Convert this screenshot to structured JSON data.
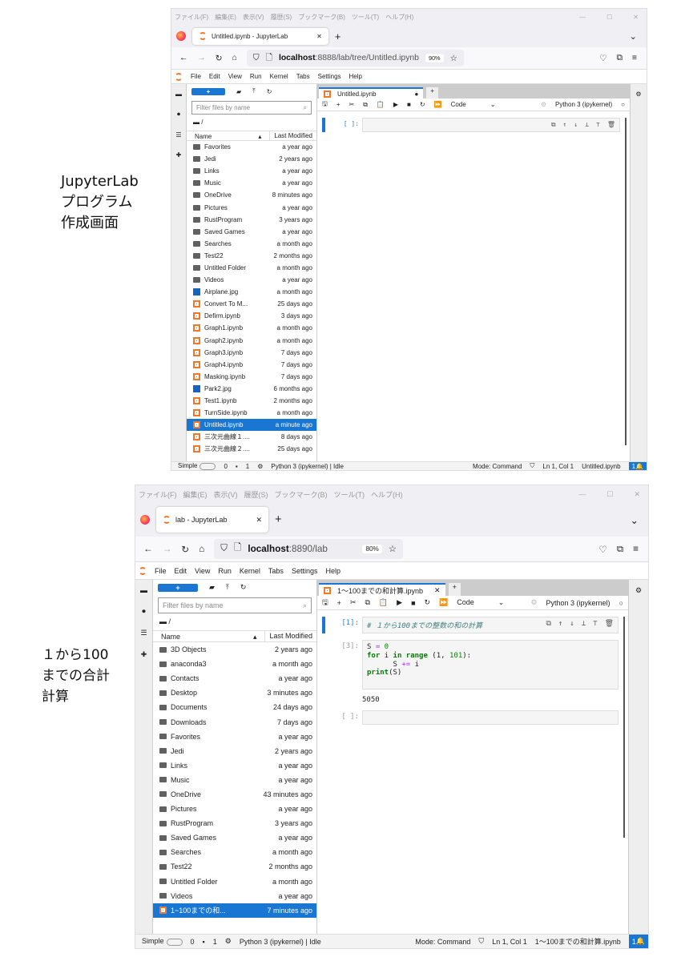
{
  "captions": [
    "JupyterLab\nプログラム\n作成画面",
    "１から100\nまでの合計\n計算"
  ],
  "panels": [
    {
      "os_menu": [
        "ファイル(F)",
        "編集(E)",
        "表示(V)",
        "履歴(S)",
        "ブックマーク(B)",
        "ツール(T)",
        "ヘルプ(H)"
      ],
      "browser_tab": "Untitled.ipynb - JupyterLab",
      "url_host": "localhost",
      "url_rest": ":8888/lab/tree/Untitled.ipynb",
      "zoom": "90%",
      "jupyter_menu": [
        "File",
        "Edit",
        "View",
        "Run",
        "Kernel",
        "Tabs",
        "Settings",
        "Help"
      ],
      "new_label": "+",
      "filter_placeholder": "Filter files by name",
      "path": "/",
      "col_name": "Name",
      "col_modified": "Last Modified",
      "files": [
        {
          "name": "Favorites",
          "modified": "a year ago",
          "type": "folder"
        },
        {
          "name": "Jedi",
          "modified": "2 years ago",
          "type": "folder"
        },
        {
          "name": "Links",
          "modified": "a year ago",
          "type": "folder"
        },
        {
          "name": "Music",
          "modified": "a year ago",
          "type": "folder"
        },
        {
          "name": "OneDrive",
          "modified": "8 minutes ago",
          "type": "folder"
        },
        {
          "name": "Pictures",
          "modified": "a year ago",
          "type": "folder"
        },
        {
          "name": "RustProgram",
          "modified": "3 years ago",
          "type": "folder"
        },
        {
          "name": "Saved Games",
          "modified": "a year ago",
          "type": "folder"
        },
        {
          "name": "Searches",
          "modified": "a month ago",
          "type": "folder"
        },
        {
          "name": "Test22",
          "modified": "2 months ago",
          "type": "folder"
        },
        {
          "name": "Untitled Folder",
          "modified": "a month ago",
          "type": "folder"
        },
        {
          "name": "Videos",
          "modified": "a year ago",
          "type": "folder"
        },
        {
          "name": "Airplane.jpg",
          "modified": "a month ago",
          "type": "image"
        },
        {
          "name": "Convert To M...",
          "modified": "25 days ago",
          "type": "notebook"
        },
        {
          "name": "Defirm.ipynb",
          "modified": "3 days ago",
          "type": "notebook"
        },
        {
          "name": "Graph1.ipynb",
          "modified": "a month ago",
          "type": "notebook"
        },
        {
          "name": "Graph2.ipynb",
          "modified": "a month ago",
          "type": "notebook"
        },
        {
          "name": "Graph3.ipynb",
          "modified": "7 days ago",
          "type": "notebook"
        },
        {
          "name": "Graph4.ipynb",
          "modified": "7 days ago",
          "type": "notebook"
        },
        {
          "name": "Masking.ipynb",
          "modified": "7 days ago",
          "type": "notebook"
        },
        {
          "name": "Park2.jpg",
          "modified": "6 months ago",
          "type": "image"
        },
        {
          "name": "Test1.ipynb",
          "modified": "2 months ago",
          "type": "notebook"
        },
        {
          "name": "TurnSide.ipynb",
          "modified": "a month ago",
          "type": "notebook"
        },
        {
          "name": "Untitled.ipynb",
          "modified": "a minute ago",
          "type": "notebook",
          "selected": true
        },
        {
          "name": "三次元曲線１....",
          "modified": "8 days ago",
          "type": "notebook"
        },
        {
          "name": "三次元曲線２....",
          "modified": "25 days ago",
          "type": "notebook"
        }
      ],
      "notebook_tab": "Untitled.ipynb",
      "cell_type": "Code",
      "kernel": "Python 3 (ipykernel)",
      "cells": [
        {
          "prompt": "[ ]:",
          "code": [],
          "active": true,
          "output": ""
        }
      ],
      "status": {
        "mode_label": "Simple",
        "count0": "0",
        "count1": "1",
        "kernel": "Python 3 (ipykernel) | Idle",
        "mode": "Mode: Command",
        "position": "Ln 1, Col 1",
        "file": "Untitled.ipynb",
        "notifications": "1"
      }
    },
    {
      "os_menu": [
        "ファイル(F)",
        "編集(E)",
        "表示(V)",
        "履歴(S)",
        "ブックマーク(B)",
        "ツール(T)",
        "ヘルプ(H)"
      ],
      "browser_tab": "lab - JupyterLab",
      "url_host": "localhost",
      "url_rest": ":8890/lab",
      "zoom": "80%",
      "jupyter_menu": [
        "File",
        "Edit",
        "View",
        "Run",
        "Kernel",
        "Tabs",
        "Settings",
        "Help"
      ],
      "new_label": "+",
      "filter_placeholder": "Filter files by name",
      "path": "/",
      "col_name": "Name",
      "col_modified": "Last Modified",
      "files": [
        {
          "name": "3D Objects",
          "modified": "2 years ago",
          "type": "folder"
        },
        {
          "name": "anaconda3",
          "modified": "a month ago",
          "type": "folder"
        },
        {
          "name": "Contacts",
          "modified": "a year ago",
          "type": "folder"
        },
        {
          "name": "Desktop",
          "modified": "3 minutes ago",
          "type": "folder"
        },
        {
          "name": "Documents",
          "modified": "24 days ago",
          "type": "folder"
        },
        {
          "name": "Downloads",
          "modified": "7 days ago",
          "type": "folder"
        },
        {
          "name": "Favorites",
          "modified": "a year ago",
          "type": "folder"
        },
        {
          "name": "Jedi",
          "modified": "2 years ago",
          "type": "folder"
        },
        {
          "name": "Links",
          "modified": "a year ago",
          "type": "folder"
        },
        {
          "name": "Music",
          "modified": "a year ago",
          "type": "folder"
        },
        {
          "name": "OneDrive",
          "modified": "43 minutes ago",
          "type": "folder"
        },
        {
          "name": "Pictures",
          "modified": "a year ago",
          "type": "folder"
        },
        {
          "name": "RustProgram",
          "modified": "3 years ago",
          "type": "folder"
        },
        {
          "name": "Saved Games",
          "modified": "a year ago",
          "type": "folder"
        },
        {
          "name": "Searches",
          "modified": "a month ago",
          "type": "folder"
        },
        {
          "name": "Test22",
          "modified": "2 months ago",
          "type": "folder"
        },
        {
          "name": "Untitled Folder",
          "modified": "a month ago",
          "type": "folder"
        },
        {
          "name": "Videos",
          "modified": "a year ago",
          "type": "folder"
        },
        {
          "name": "1~100までの和...",
          "modified": "7 minutes ago",
          "type": "notebook",
          "selected": true
        }
      ],
      "notebook_tab": "1～100までの和計算.ipynb",
      "cell_type": "Code",
      "kernel": "Python 3 (ipykernel)",
      "cells": [
        {
          "prompt": "[1]:",
          "active": true,
          "code": [
            [
              [
                "cm",
                "# １から100までの整数の和の計算"
              ]
            ]
          ],
          "output": ""
        },
        {
          "prompt": "[3]:",
          "active": false,
          "code": [
            [
              [
                "",
                "S "
              ],
              [
                "op",
                "="
              ],
              [
                "num",
                " 0"
              ]
            ],
            [
              [
                "kw",
                "for"
              ],
              [
                "",
                " i "
              ],
              [
                "kw",
                "in"
              ],
              [
                "",
                " "
              ],
              [
                "kw",
                "range"
              ],
              [
                "",
                " (1, "
              ],
              [
                "num",
                "101"
              ],
              [
                "",
                "):"
              ]
            ],
            [
              [
                "",
                "      S "
              ],
              [
                "op",
                "+="
              ],
              [
                "",
                " i"
              ]
            ],
            [
              [
                "kw",
                "print"
              ],
              [
                "",
                "(S)"
              ]
            ],
            [
              [
                "",
                ""
              ]
            ]
          ],
          "output": "5050"
        },
        {
          "prompt": "[ ]:",
          "active": false,
          "code": [],
          "output": ""
        }
      ],
      "status": {
        "mode_label": "Simple",
        "count0": "0",
        "count1": "1",
        "kernel": "Python 3 (ipykernel) | Idle",
        "mode": "Mode: Command",
        "position": "Ln 1, Col 1",
        "file": "1～100までの和計算.ipynb",
        "notifications": "1"
      }
    }
  ]
}
